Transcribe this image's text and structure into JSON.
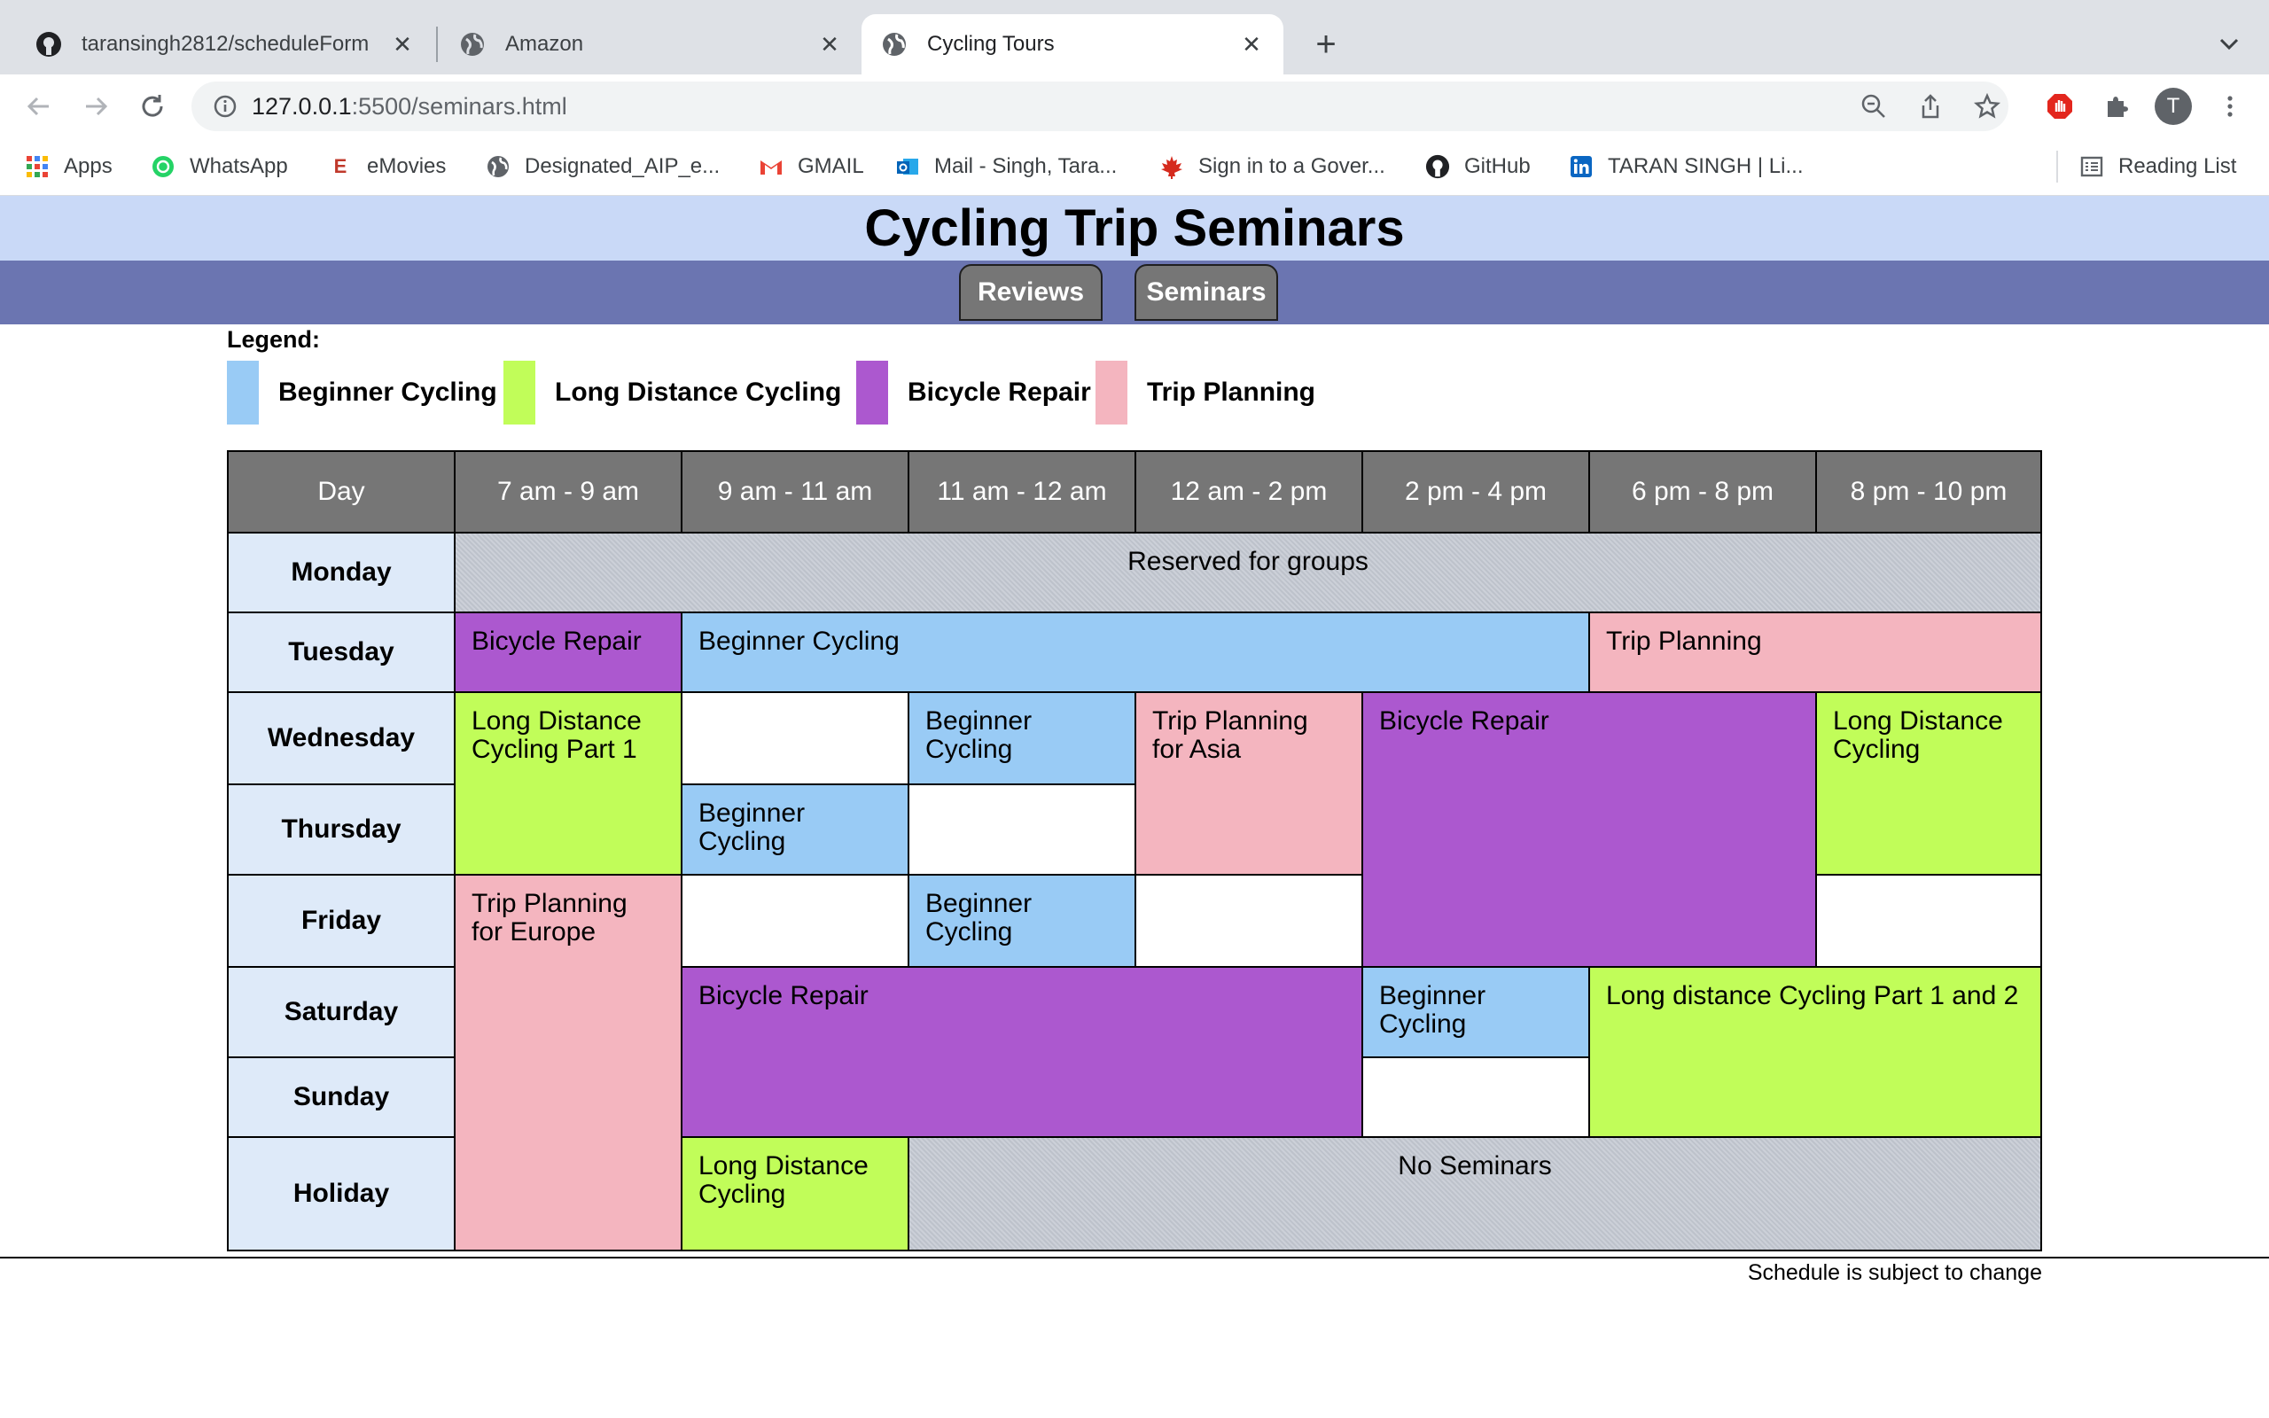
{
  "browser": {
    "tabs": [
      {
        "title": "taransingh2812/scheduleForm",
        "icon": "github-icon"
      },
      {
        "title": "Amazon",
        "icon": "globe-icon"
      },
      {
        "title": "Cycling Tours",
        "icon": "globe-icon",
        "active": true
      }
    ],
    "url_host": "127.0.0.1",
    "url_path": ":5500/seminars.html",
    "profile_initial": "T",
    "bookmarks": [
      {
        "label": "Apps"
      },
      {
        "label": "WhatsApp"
      },
      {
        "label": "eMovies"
      },
      {
        "label": "Designated_AIP_e..."
      },
      {
        "label": "GMAIL"
      },
      {
        "label": "Mail - Singh, Tara..."
      },
      {
        "label": "Sign in to a Gover..."
      },
      {
        "label": "GitHub"
      },
      {
        "label": "TARAN SINGH | Li..."
      }
    ],
    "reading_list": "Reading List"
  },
  "page": {
    "title": "Cycling Trip Seminars",
    "nav": [
      "Reviews",
      "Seminars"
    ],
    "legend_title": "Legend:",
    "legend": [
      {
        "label": "Beginner Cycling",
        "color": "#99cbf5"
      },
      {
        "label": "Long Distance Cycling",
        "color": "#c1fd59"
      },
      {
        "label": "Bicycle Repair",
        "color": "#ac58cf"
      },
      {
        "label": "Trip Planning",
        "color": "#f4b5bf"
      }
    ],
    "columns": [
      "Day",
      "7 am - 9 am",
      "9 am - 11 am",
      "11 am - 12 am",
      "12 am - 2 pm",
      "2 pm - 4 pm",
      "6 pm - 8 pm",
      "8 pm - 10 pm"
    ],
    "days": [
      "Monday",
      "Tuesday",
      "Wednesday",
      "Thursday",
      "Friday",
      "Saturday",
      "Sunday",
      "Holiday"
    ],
    "sessions": {
      "monday_reserved": "Reserved for groups",
      "tue_repair": "Bicycle Repair",
      "tue_beginner": "Beginner Cycling",
      "tue_trip": "Trip Planning",
      "wed_long": "Long Distance Cycling Part 1",
      "wed_beginner": "Beginner Cycling",
      "wed_trip_asia": "Trip Planning for Asia",
      "wed_repair": "Bicycle Repair",
      "wed_long_late": "Long Distance Cycling",
      "thu_beginner": "Beginner Cycling",
      "fri_trip_europe": "Trip Planning for Europe",
      "fri_beginner": "Beginner Cycling",
      "sat_repair": "Bicycle Repair",
      "sat_beginner": "Beginner Cycling",
      "sat_long": "Long distance Cycling Part 1 and 2",
      "hol_long": "Long Distance Cycling",
      "hol_none": "No Seminars"
    },
    "footnote": "Schedule is subject to change"
  }
}
